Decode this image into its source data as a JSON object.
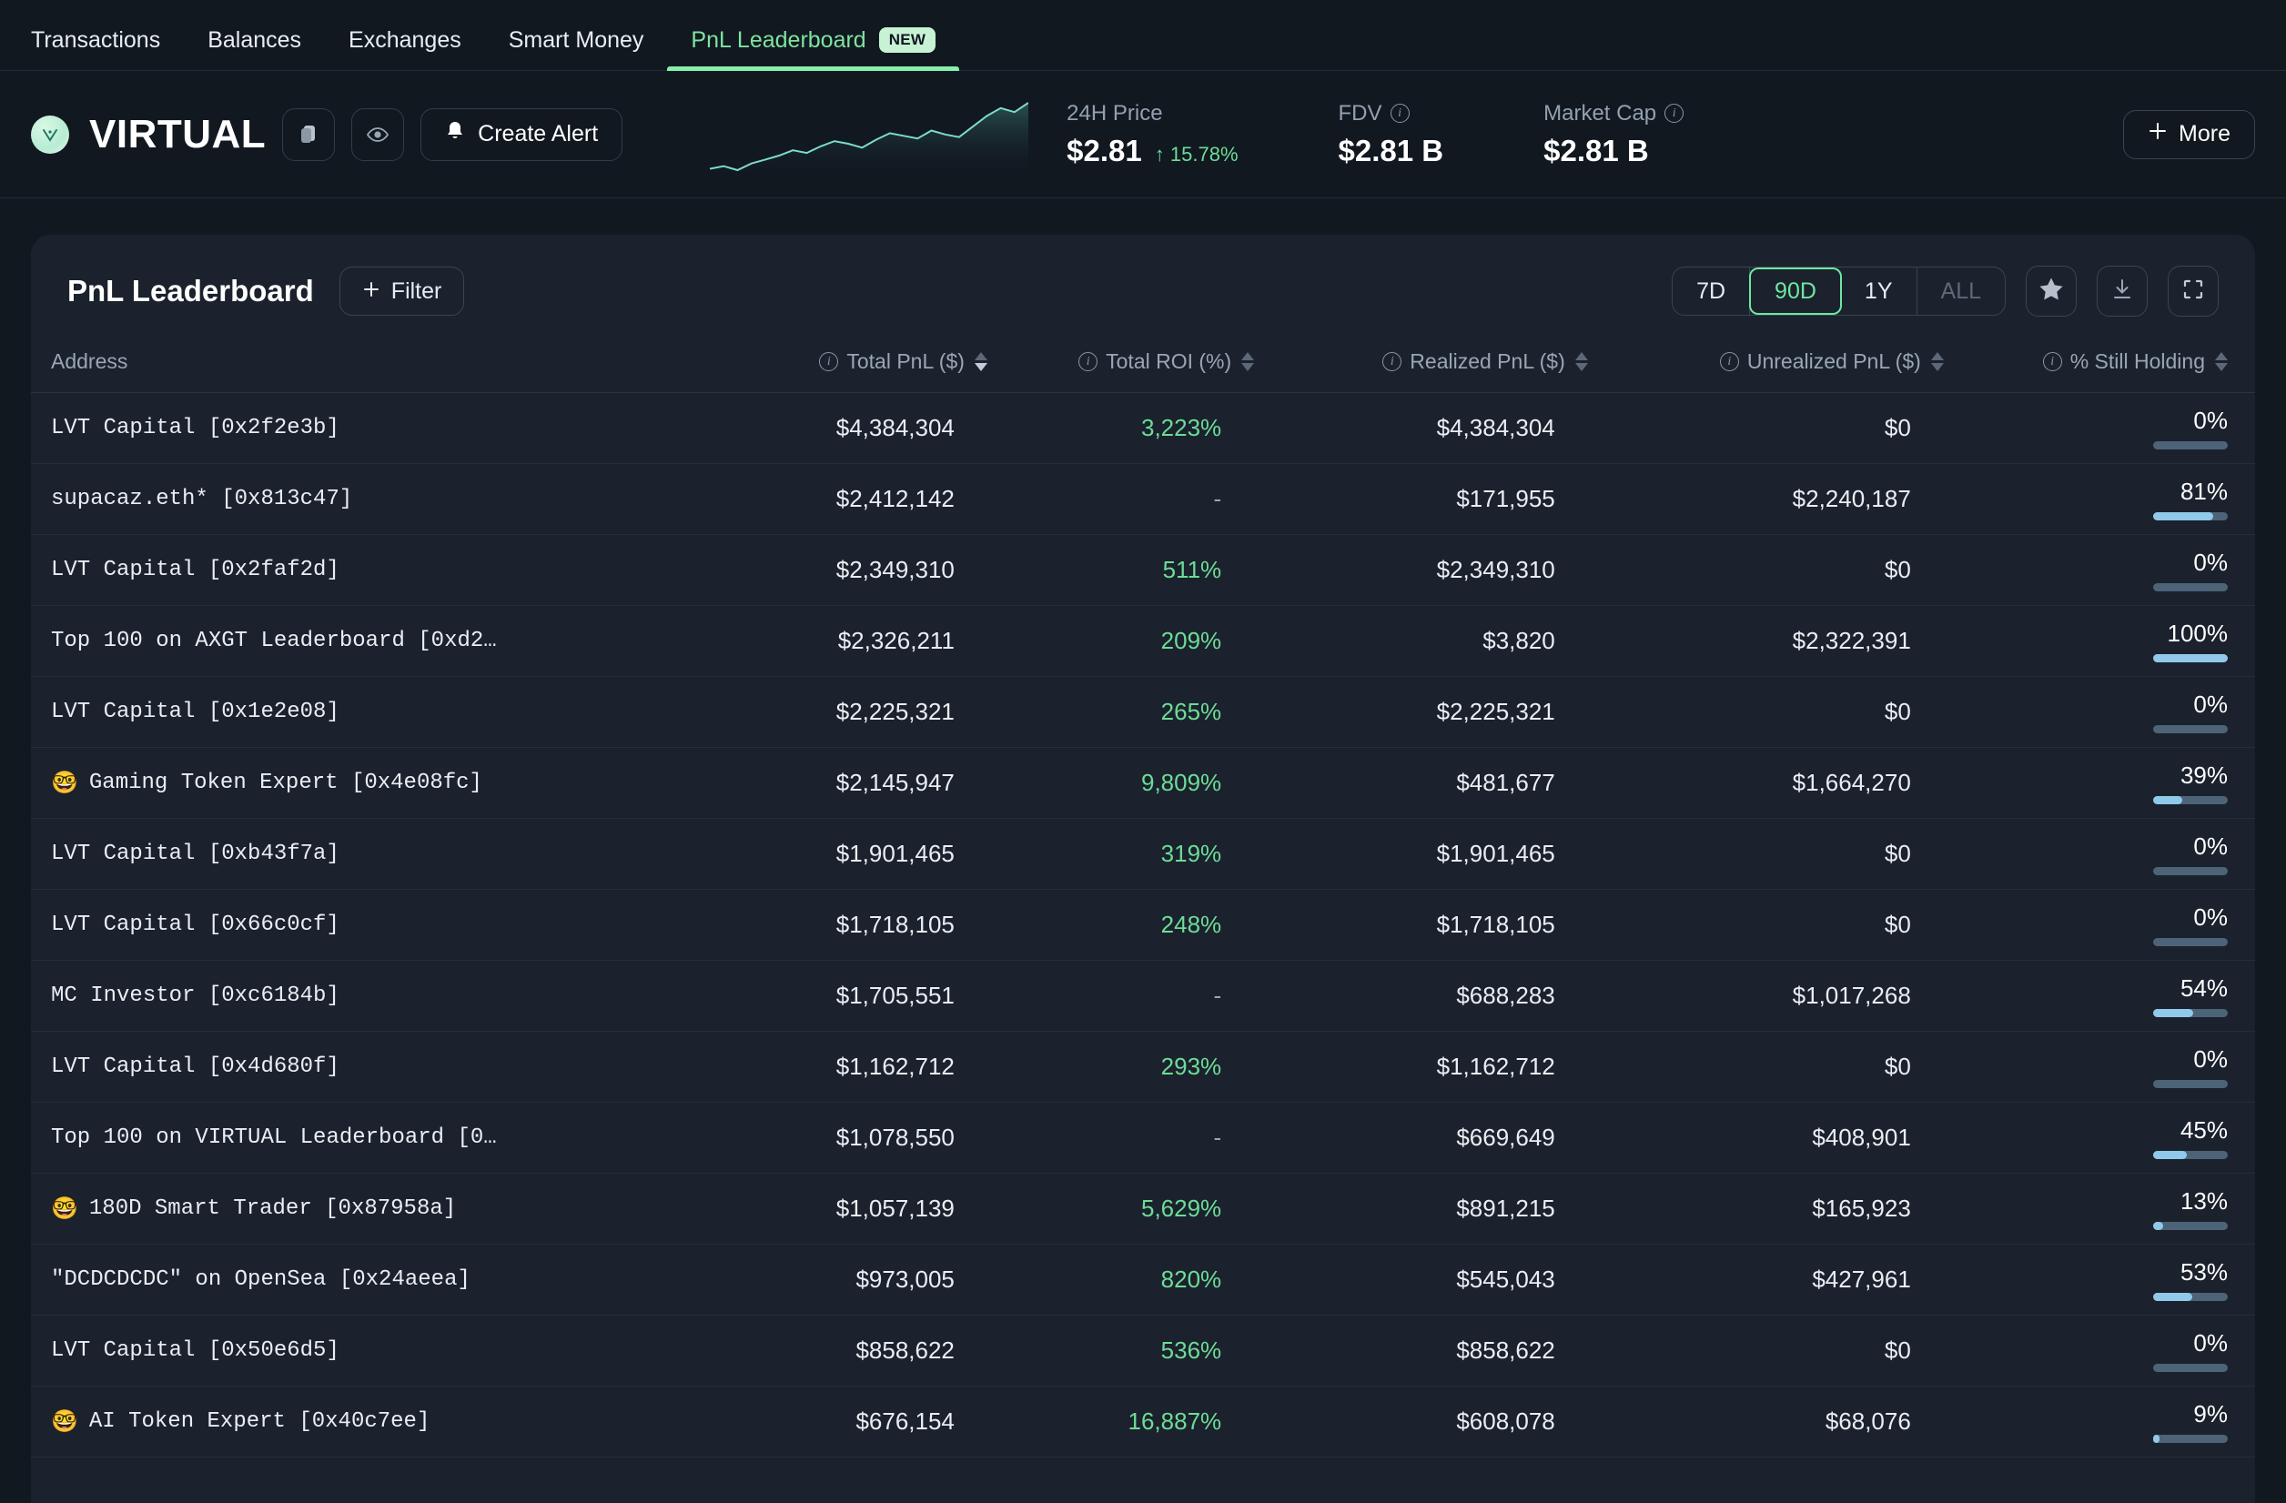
{
  "nav": {
    "tabs": [
      {
        "label": "Transactions",
        "active": false
      },
      {
        "label": "Balances",
        "active": false
      },
      {
        "label": "Exchanges",
        "active": false
      },
      {
        "label": "Smart Money",
        "active": false
      },
      {
        "label": "PnL Leaderboard",
        "active": true,
        "badge": "NEW"
      }
    ]
  },
  "token": {
    "symbol": "VIRTUAL",
    "logo_glyph": "♈",
    "copy_icon": "copy-icon",
    "watch_icon": "eye-icon",
    "alert_button": "Create Alert",
    "more_button": "More",
    "stats": [
      {
        "label": "24H Price",
        "value": "$2.81",
        "change": "15.78%",
        "change_dir": "up",
        "info": false
      },
      {
        "label": "FDV",
        "value": "$2.81 B",
        "info": true
      },
      {
        "label": "Market Cap",
        "value": "$2.81 B",
        "info": true
      }
    ],
    "sparkline": [
      12,
      14,
      11,
      16,
      19,
      22,
      26,
      24,
      29,
      33,
      31,
      28,
      34,
      39,
      37,
      35,
      41,
      38,
      36,
      44,
      52,
      58,
      55,
      62
    ]
  },
  "panel": {
    "title": "PnL Leaderboard",
    "filter_label": "Filter",
    "ranges": [
      {
        "label": "7D",
        "state": "normal"
      },
      {
        "label": "90D",
        "state": "active"
      },
      {
        "label": "1Y",
        "state": "normal"
      },
      {
        "label": "ALL",
        "state": "disabled"
      }
    ],
    "actions": [
      {
        "name": "favorite-button",
        "icon": "star-icon"
      },
      {
        "name": "download-button",
        "icon": "download-icon"
      },
      {
        "name": "fullscreen-button",
        "icon": "expand-icon"
      }
    ],
    "columns": [
      {
        "label": "Address",
        "info": false,
        "align": "left",
        "sort": "none"
      },
      {
        "label": "Total PnL ($)",
        "info": true,
        "align": "right",
        "sort": "desc"
      },
      {
        "label": "Total ROI (%)",
        "info": true,
        "align": "right",
        "sort": "none"
      },
      {
        "label": "Realized PnL ($)",
        "info": true,
        "align": "right",
        "sort": "none"
      },
      {
        "label": "Unrealized PnL ($)",
        "info": true,
        "align": "right",
        "sort": "none"
      },
      {
        "label": "% Still Holding",
        "info": true,
        "align": "right",
        "sort": "none"
      }
    ],
    "rows": [
      {
        "emoji": "",
        "address": "LVT Capital [0x2f2e3b]",
        "total_pnl": "$4,384,304",
        "roi": "3,223%",
        "realized": "$4,384,304",
        "unrealized": "$0",
        "holding": "0%",
        "holding_pct": 0
      },
      {
        "emoji": "",
        "address": "supacaz.eth* [0x813c47]",
        "total_pnl": "$2,412,142",
        "roi": "-",
        "realized": "$171,955",
        "unrealized": "$2,240,187",
        "holding": "81%",
        "holding_pct": 81
      },
      {
        "emoji": "",
        "address": "LVT Capital [0x2faf2d]",
        "total_pnl": "$2,349,310",
        "roi": "511%",
        "realized": "$2,349,310",
        "unrealized": "$0",
        "holding": "0%",
        "holding_pct": 0
      },
      {
        "emoji": "",
        "address": "Top 100 on AXGT Leaderboard [0xd2…",
        "total_pnl": "$2,326,211",
        "roi": "209%",
        "realized": "$3,820",
        "unrealized": "$2,322,391",
        "holding": "100%",
        "holding_pct": 100
      },
      {
        "emoji": "",
        "address": "LVT Capital [0x1e2e08]",
        "total_pnl": "$2,225,321",
        "roi": "265%",
        "realized": "$2,225,321",
        "unrealized": "$0",
        "holding": "0%",
        "holding_pct": 0
      },
      {
        "emoji": "🤓",
        "address": "Gaming Token Expert [0x4e08fc]",
        "total_pnl": "$2,145,947",
        "roi": "9,809%",
        "realized": "$481,677",
        "unrealized": "$1,664,270",
        "holding": "39%",
        "holding_pct": 39
      },
      {
        "emoji": "",
        "address": "LVT Capital [0xb43f7a]",
        "total_pnl": "$1,901,465",
        "roi": "319%",
        "realized": "$1,901,465",
        "unrealized": "$0",
        "holding": "0%",
        "holding_pct": 0
      },
      {
        "emoji": "",
        "address": "LVT Capital [0x66c0cf]",
        "total_pnl": "$1,718,105",
        "roi": "248%",
        "realized": "$1,718,105",
        "unrealized": "$0",
        "holding": "0%",
        "holding_pct": 0
      },
      {
        "emoji": "",
        "address": "MC Investor [0xc6184b]",
        "total_pnl": "$1,705,551",
        "roi": "-",
        "realized": "$688,283",
        "unrealized": "$1,017,268",
        "holding": "54%",
        "holding_pct": 54
      },
      {
        "emoji": "",
        "address": "LVT Capital [0x4d680f]",
        "total_pnl": "$1,162,712",
        "roi": "293%",
        "realized": "$1,162,712",
        "unrealized": "$0",
        "holding": "0%",
        "holding_pct": 0
      },
      {
        "emoji": "",
        "address": "Top 100 on VIRTUAL Leaderboard [0…",
        "total_pnl": "$1,078,550",
        "roi": "-",
        "realized": "$669,649",
        "unrealized": "$408,901",
        "holding": "45%",
        "holding_pct": 45
      },
      {
        "emoji": "🤓",
        "address": "180D Smart Trader [0x87958a]",
        "total_pnl": "$1,057,139",
        "roi": "5,629%",
        "realized": "$891,215",
        "unrealized": "$165,923",
        "holding": "13%",
        "holding_pct": 13
      },
      {
        "emoji": "",
        "address": "\"DCDCDCDC\" on OpenSea [0x24aeea]",
        "total_pnl": "$973,005",
        "roi": "820%",
        "realized": "$545,043",
        "unrealized": "$427,961",
        "holding": "53%",
        "holding_pct": 53
      },
      {
        "emoji": "",
        "address": "LVT Capital [0x50e6d5]",
        "total_pnl": "$858,622",
        "roi": "536%",
        "realized": "$858,622",
        "unrealized": "$0",
        "holding": "0%",
        "holding_pct": 0
      },
      {
        "emoji": "🤓",
        "address": "AI Token Expert [0x40c7ee]",
        "total_pnl": "$676,154",
        "roi": "16,887%",
        "realized": "$608,078",
        "unrealized": "$68,076",
        "holding": "9%",
        "holding_pct": 9
      }
    ]
  },
  "colors": {
    "page_bg": "#111820",
    "card_bg": "#1b222d",
    "accent_green": "#6ee7a0",
    "positive": "#6ddc97",
    "bar_fill": "#90c9ea",
    "bar_track": "#4d6378"
  }
}
